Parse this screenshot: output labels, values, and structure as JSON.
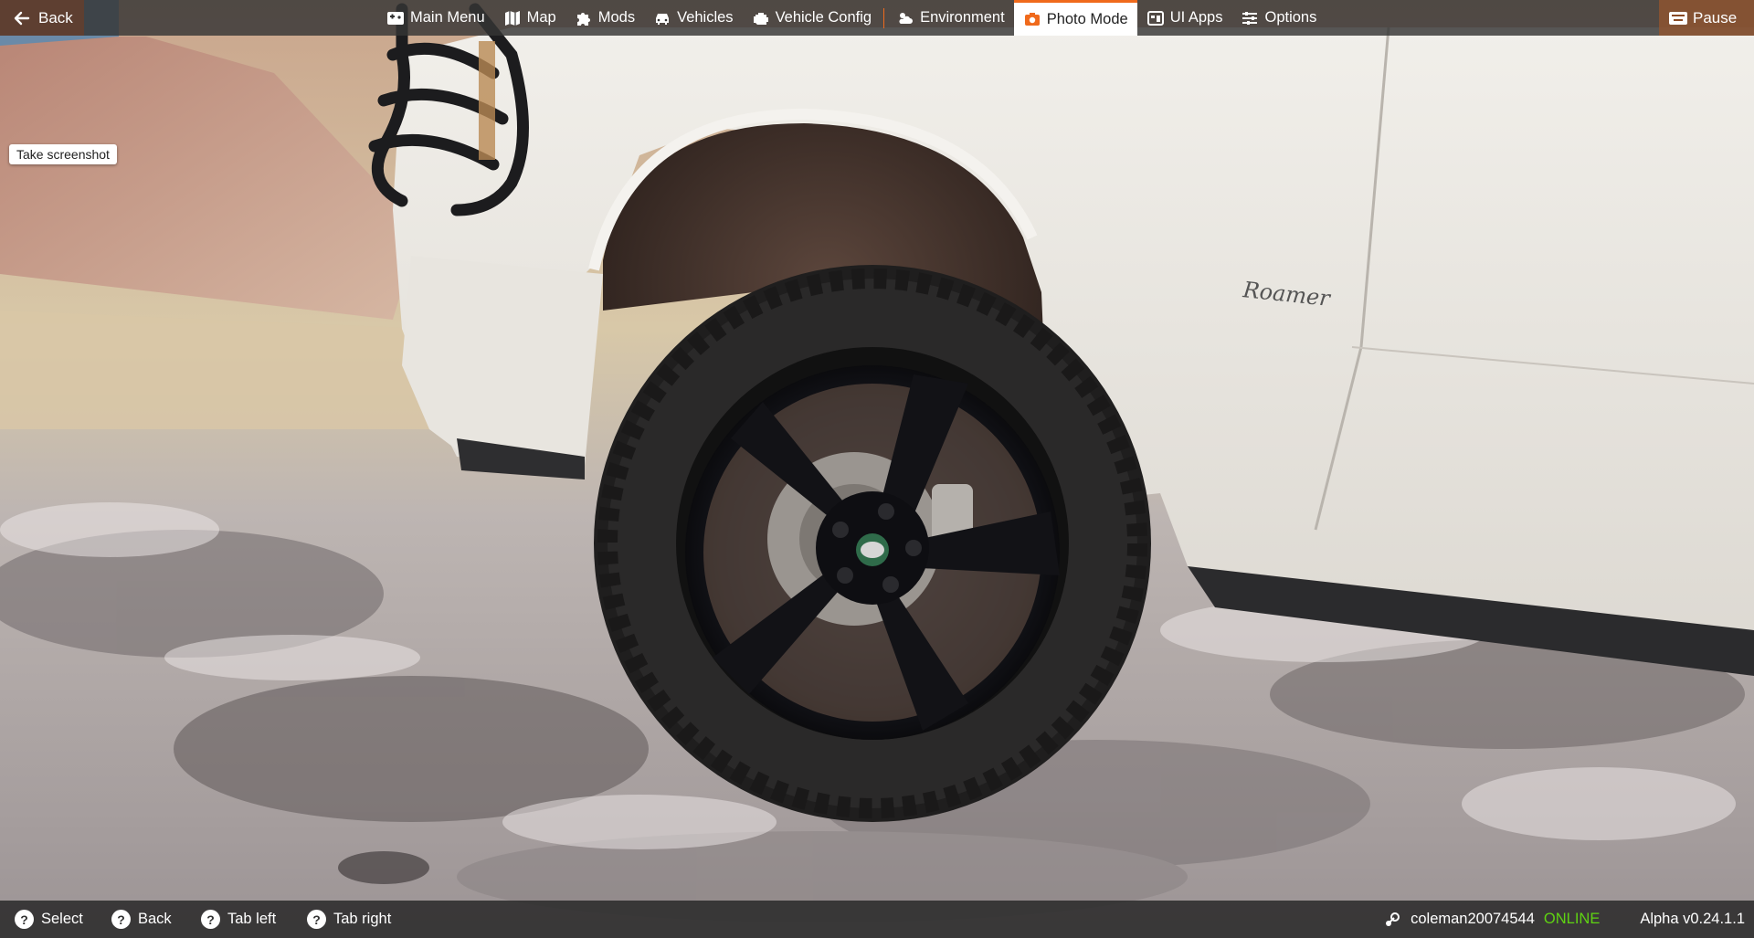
{
  "topbar": {
    "back_label": "Back",
    "pause_label": "Pause",
    "menu": [
      {
        "label": "Main Menu",
        "icon": "main-menu-icon",
        "active": false
      },
      {
        "label": "Map",
        "icon": "map-icon",
        "active": false
      },
      {
        "label": "Mods",
        "icon": "puzzle-icon",
        "active": false
      },
      {
        "label": "Vehicles",
        "icon": "car-icon",
        "active": false
      },
      {
        "label": "Vehicle Config",
        "icon": "engine-icon",
        "active": false
      },
      {
        "label": "Environment",
        "icon": "weather-icon",
        "active": false
      },
      {
        "label": "Photo Mode",
        "icon": "camera-icon",
        "active": true
      },
      {
        "label": "UI Apps",
        "icon": "ui-apps-icon",
        "active": false
      },
      {
        "label": "Options",
        "icon": "sliders-icon",
        "active": false
      }
    ]
  },
  "tooltip": {
    "text": "Take screenshot"
  },
  "scene": {
    "badge_text": "Roamer"
  },
  "bottombar": {
    "hints": [
      {
        "key": "?",
        "label": "Select"
      },
      {
        "key": "?",
        "label": "Back"
      },
      {
        "key": "?",
        "label": "Tab left"
      },
      {
        "key": "?",
        "label": "Tab right"
      }
    ],
    "username": "coleman20074544",
    "online_status": "ONLINE",
    "version": "Alpha v0.24.1.1"
  },
  "colors": {
    "accent": "#f06a1c",
    "online": "#5fd312",
    "bar_bg": "#343434"
  }
}
